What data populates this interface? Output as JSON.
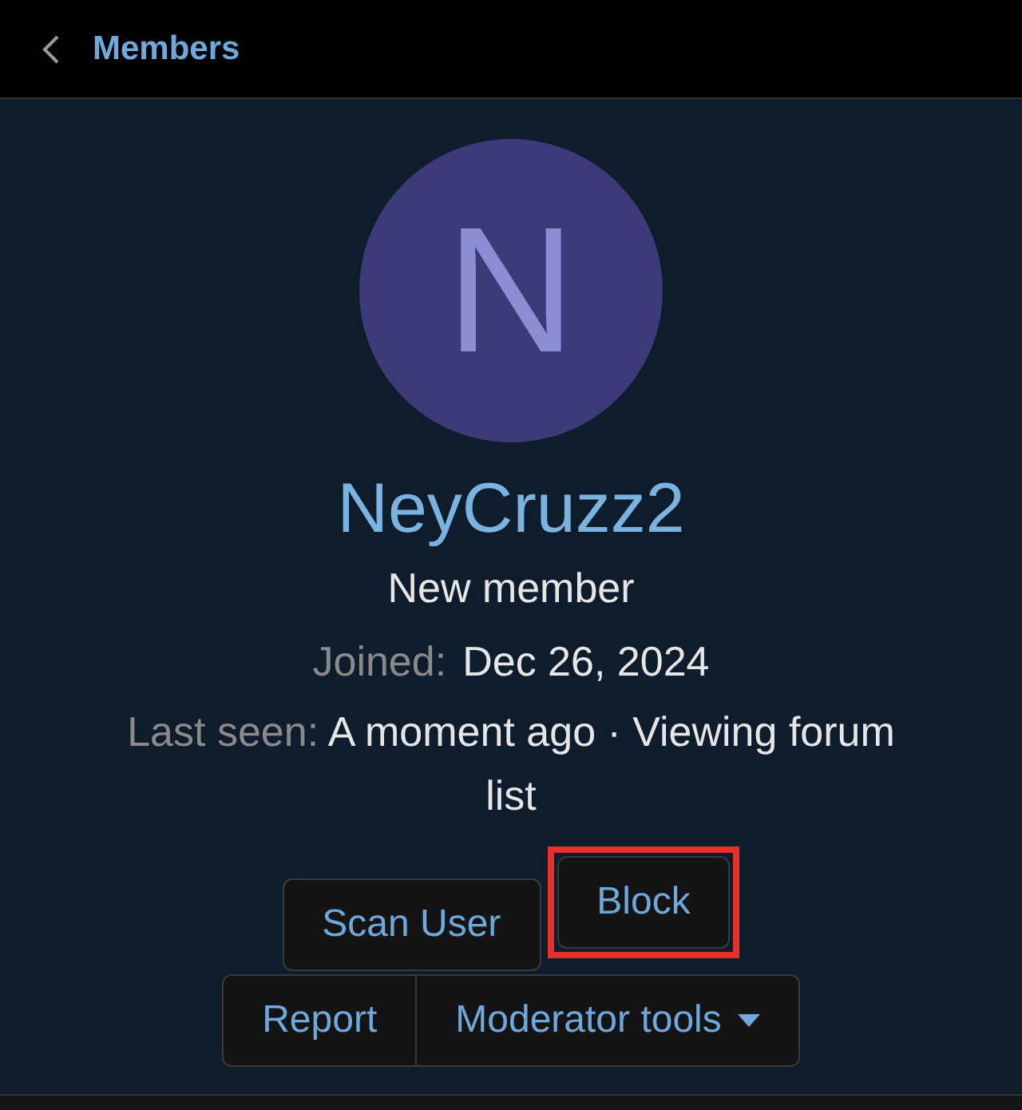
{
  "header": {
    "back_label": "Members"
  },
  "profile": {
    "avatar_letter": "N",
    "username": "NeyCruzz2",
    "role": "New member",
    "joined_label": "Joined:",
    "joined_value": "Dec 26, 2024",
    "last_seen_label": "Last seen:",
    "last_seen_value": "A moment ago · Viewing forum list"
  },
  "action_rows": [
    [
      {
        "label": "Scan User",
        "highlighted": false
      },
      {
        "label": "Block",
        "highlighted": true
      }
    ],
    [
      {
        "label": "Report",
        "highlighted": false,
        "kind": "plain"
      },
      {
        "label": "Moderator tools",
        "highlighted": false,
        "kind": "dropdown"
      }
    ]
  ]
}
